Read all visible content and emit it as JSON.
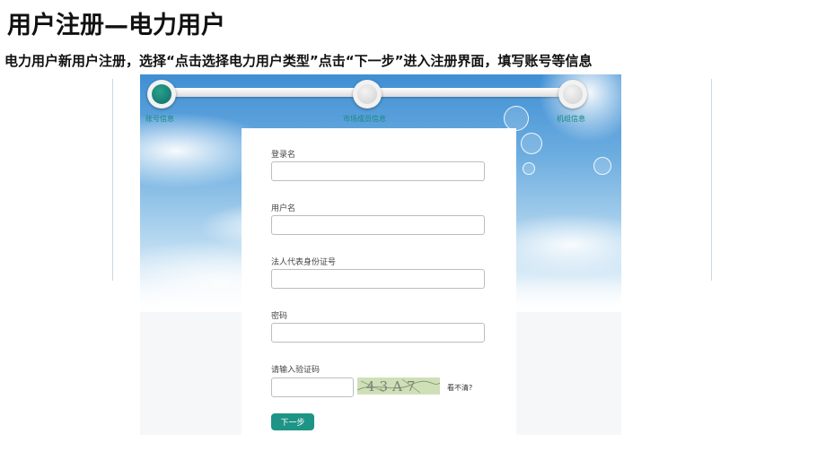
{
  "page": {
    "title": "用户注册—电力用户",
    "subtitle": "电力用户新用户注册，选择“点击选择电力用户类型”点击“下一步”进入注册界面，填写账号等信息"
  },
  "steps": [
    {
      "label": "账号信息",
      "active": true
    },
    {
      "label": "市场成员信息",
      "active": false
    },
    {
      "label": "机组信息",
      "active": false
    }
  ],
  "form": {
    "login_name_label": "登录名",
    "login_name_value": "",
    "username_label": "用户名",
    "username_value": "",
    "id_label": "法人代表身份证号",
    "id_value": "",
    "password_label": "密码",
    "password_value": "",
    "captcha_label": "请输入验证码",
    "captcha_value": "",
    "captcha_text": "43A7",
    "refresh_label": "看不清?",
    "next_label": "下一步"
  },
  "colors": {
    "accent": "#1e9486",
    "step_label": "#1a8a7f",
    "sky_top": "#3f8fd4"
  }
}
